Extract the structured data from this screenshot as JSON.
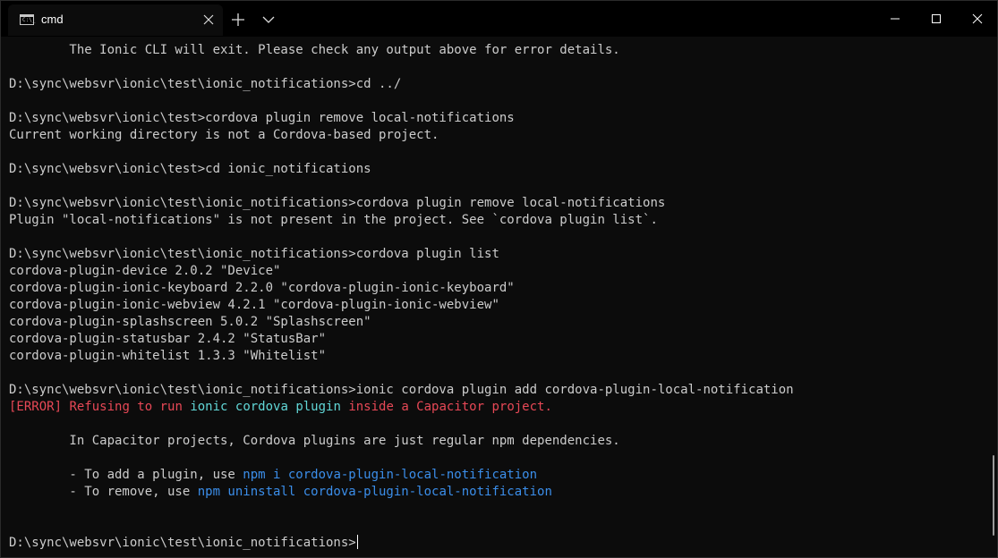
{
  "window": {
    "tab_title": "cmd",
    "icon_glyph": "C:\\_"
  },
  "colors": {
    "background": "#0c0c0c",
    "foreground": "#cccccc",
    "error_red": "#e74856",
    "cyan": "#61d6d6",
    "blue": "#3b8eea"
  },
  "icons": {
    "tab_icon": "console-icon",
    "close_tab": "close-icon",
    "new_tab": "plus-icon",
    "dropdown": "chevron-down-icon",
    "minimize": "minimize-icon",
    "maximize": "maximize-icon",
    "close_window": "close-icon"
  },
  "terminal": {
    "line_0": "        The Ionic CLI will exit. Please check any output above for error details.",
    "line_2": "D:\\sync\\websvr\\ionic\\test\\ionic_notifications>cd ../",
    "line_4": "D:\\sync\\websvr\\ionic\\test>cordova plugin remove local-notifications",
    "line_5": "Current working directory is not a Cordova-based project.",
    "line_7": "D:\\sync\\websvr\\ionic\\test>cd ionic_notifications",
    "line_9": "D:\\sync\\websvr\\ionic\\test\\ionic_notifications>cordova plugin remove local-notifications",
    "line_10": "Plugin \"local-notifications\" is not present in the project. See `cordova plugin list`.",
    "line_12": "D:\\sync\\websvr\\ionic\\test\\ionic_notifications>cordova plugin list",
    "line_13": "cordova-plugin-device 2.0.2 \"Device\"",
    "line_14": "cordova-plugin-ionic-keyboard 2.2.0 \"cordova-plugin-ionic-keyboard\"",
    "line_15": "cordova-plugin-ionic-webview 4.2.1 \"cordova-plugin-ionic-webview\"",
    "line_16": "cordova-plugin-splashscreen 5.0.2 \"Splashscreen\"",
    "line_17": "cordova-plugin-statusbar 2.4.2 \"StatusBar\"",
    "line_18": "cordova-plugin-whitelist 1.3.3 \"Whitelist\"",
    "line_20": "D:\\sync\\websvr\\ionic\\test\\ionic_notifications>ionic cordova plugin add cordova-plugin-local-notification",
    "error_line": {
      "tag": "[ERROR]",
      "text_a": " Refusing to run ",
      "command": "ionic cordova plugin",
      "text_b": " inside a Capacitor project."
    },
    "line_23": "        In Capacitor projects, Cordova plugins are just regular npm dependencies.",
    "add_line": {
      "prefix": "        - To add a plugin, use ",
      "command": "npm i cordova-plugin-local-notification"
    },
    "remove_line": {
      "prefix": "        - To remove, use ",
      "command": "npm uninstall cordova-plugin-local-notification"
    },
    "prompt": "D:\\sync\\websvr\\ionic\\test\\ionic_notifications>"
  }
}
